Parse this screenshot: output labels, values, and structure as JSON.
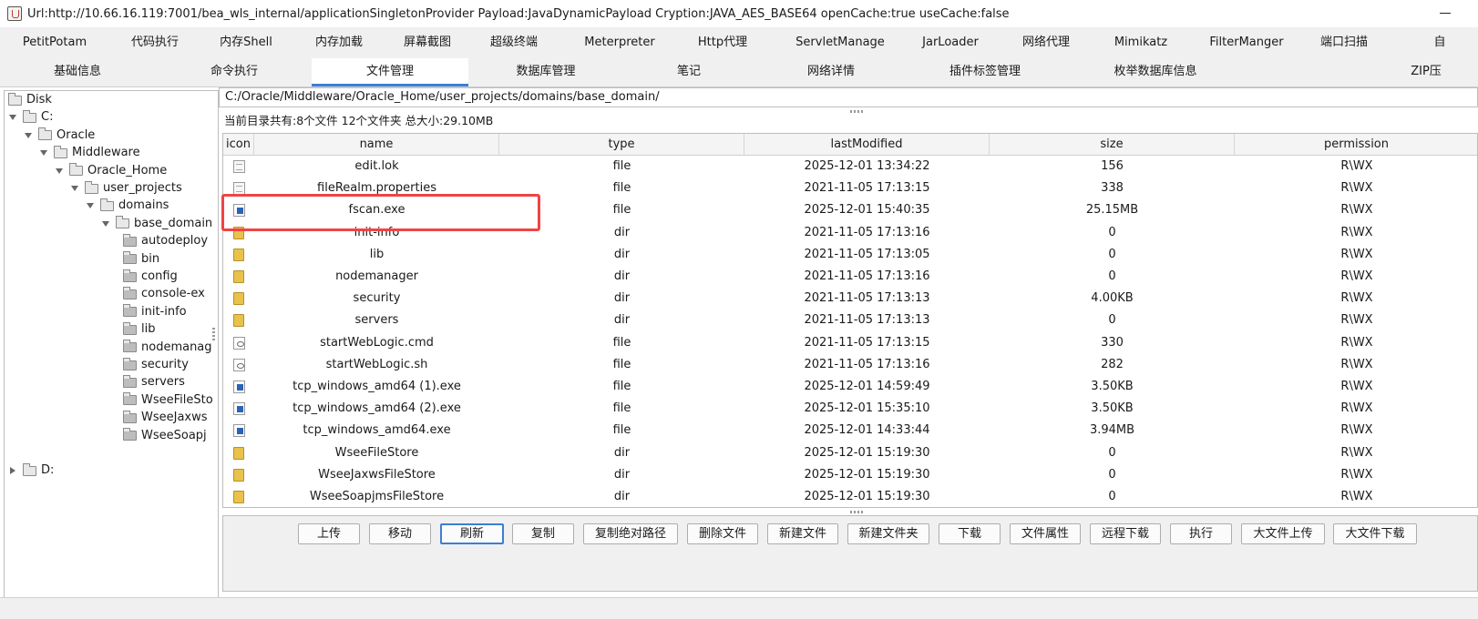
{
  "window": {
    "title": "Url:http://10.66.16.119:7001/bea_wls_internal/applicationSingletonProvider Payload:JavaDynamicPayload Cryption:JAVA_AES_BASE64 openCache:true useCache:false"
  },
  "plugin_tabs": [
    "PetitPotam",
    "代码执行",
    "内存Shell",
    "内存加载",
    "屏幕截图",
    "超级终端",
    "Meterpreter",
    "Http代理",
    "ServletManage",
    "JarLoader",
    "网络代理",
    "Mimikatz",
    "FilterManger",
    "端口扫描",
    "自"
  ],
  "sub_tabs": [
    "基础信息",
    "命令执行",
    "文件管理",
    "数据库管理",
    "笔记",
    "网络详情",
    "插件标签管理",
    "枚举数据库信息",
    "ZIP压"
  ],
  "active_sub_tab": "文件管理",
  "tree": [
    {
      "label": "Disk",
      "depth": 0,
      "state": "root"
    },
    {
      "label": "C:",
      "depth": 0,
      "state": "open"
    },
    {
      "label": "Oracle",
      "depth": 1,
      "state": "open"
    },
    {
      "label": "Middleware",
      "depth": 2,
      "state": "open"
    },
    {
      "label": "Oracle_Home",
      "depth": 3,
      "state": "open"
    },
    {
      "label": "user_projects",
      "depth": 4,
      "state": "open"
    },
    {
      "label": "domains",
      "depth": 5,
      "state": "open"
    },
    {
      "label": "base_domain",
      "depth": 6,
      "state": "open"
    },
    {
      "label": "autodeploy",
      "depth": 7,
      "state": "leaf"
    },
    {
      "label": "bin",
      "depth": 7,
      "state": "leaf"
    },
    {
      "label": "config",
      "depth": 7,
      "state": "leaf"
    },
    {
      "label": "console-ex",
      "depth": 7,
      "state": "leaf"
    },
    {
      "label": "init-info",
      "depth": 7,
      "state": "leaf"
    },
    {
      "label": "lib",
      "depth": 7,
      "state": "leaf"
    },
    {
      "label": "nodemanag",
      "depth": 7,
      "state": "leaf"
    },
    {
      "label": "security",
      "depth": 7,
      "state": "leaf"
    },
    {
      "label": "servers",
      "depth": 7,
      "state": "leaf"
    },
    {
      "label": "WseeFileSto",
      "depth": 7,
      "state": "leaf"
    },
    {
      "label": "WseeJaxws",
      "depth": 7,
      "state": "leaf"
    },
    {
      "label": "WseeSoapj",
      "depth": 7,
      "state": "leaf"
    },
    {
      "label": "D:",
      "depth": 0,
      "state": "closed"
    }
  ],
  "path": "C:/Oracle/Middleware/Oracle_Home/user_projects/domains/base_domain/",
  "summary": "当前目录共有:8个文件 12个文件夹 总大小:29.10MB",
  "table": {
    "columns": [
      "icon",
      "name",
      "type",
      "lastModified",
      "size",
      "permission"
    ],
    "rows": [
      {
        "icon": "file",
        "name": "edit.lok",
        "type": "file",
        "lastModified": "2025-12-01 13:34:22",
        "size": "156",
        "permission": "R\\WX"
      },
      {
        "icon": "file",
        "name": "fileRealm.properties",
        "type": "file",
        "lastModified": "2021-11-05 17:13:15",
        "size": "338",
        "permission": "R\\WX"
      },
      {
        "icon": "exe",
        "name": "fscan.exe",
        "type": "file",
        "lastModified": "2025-12-01 15:40:35",
        "size": "25.15MB",
        "permission": "R\\WX"
      },
      {
        "icon": "dir",
        "name": "init-info",
        "type": "dir",
        "lastModified": "2021-11-05 17:13:16",
        "size": "0",
        "permission": "R\\WX"
      },
      {
        "icon": "dir",
        "name": "lib",
        "type": "dir",
        "lastModified": "2021-11-05 17:13:05",
        "size": "0",
        "permission": "R\\WX"
      },
      {
        "icon": "dir",
        "name": "nodemanager",
        "type": "dir",
        "lastModified": "2021-11-05 17:13:16",
        "size": "0",
        "permission": "R\\WX"
      },
      {
        "icon": "dir",
        "name": "security",
        "type": "dir",
        "lastModified": "2021-11-05 17:13:13",
        "size": "4.00KB",
        "permission": "R\\WX"
      },
      {
        "icon": "dir",
        "name": "servers",
        "type": "dir",
        "lastModified": "2021-11-05 17:13:13",
        "size": "0",
        "permission": "R\\WX"
      },
      {
        "icon": "script",
        "name": "startWebLogic.cmd",
        "type": "file",
        "lastModified": "2021-11-05 17:13:15",
        "size": "330",
        "permission": "R\\WX"
      },
      {
        "icon": "script",
        "name": "startWebLogic.sh",
        "type": "file",
        "lastModified": "2021-11-05 17:13:16",
        "size": "282",
        "permission": "R\\WX"
      },
      {
        "icon": "exe",
        "name": "tcp_windows_amd64 (1).exe",
        "type": "file",
        "lastModified": "2025-12-01 14:59:49",
        "size": "3.50KB",
        "permission": "R\\WX"
      },
      {
        "icon": "exe",
        "name": "tcp_windows_amd64 (2).exe",
        "type": "file",
        "lastModified": "2025-12-01 15:35:10",
        "size": "3.50KB",
        "permission": "R\\WX"
      },
      {
        "icon": "exe",
        "name": "tcp_windows_amd64.exe",
        "type": "file",
        "lastModified": "2025-12-01 14:33:44",
        "size": "3.94MB",
        "permission": "R\\WX"
      },
      {
        "icon": "dir",
        "name": "WseeFileStore",
        "type": "dir",
        "lastModified": "2025-12-01 15:19:30",
        "size": "0",
        "permission": "R\\WX"
      },
      {
        "icon": "dir",
        "name": "WseeJaxwsFileStore",
        "type": "dir",
        "lastModified": "2025-12-01 15:19:30",
        "size": "0",
        "permission": "R\\WX"
      },
      {
        "icon": "dir",
        "name": "WseeSoapjmsFileStore",
        "type": "dir",
        "lastModified": "2025-12-01 15:19:30",
        "size": "0",
        "permission": "R\\WX"
      }
    ]
  },
  "buttons": [
    "上传",
    "移动",
    "刷新",
    "复制",
    "复制绝对路径",
    "删除文件",
    "新建文件",
    "新建文件夹",
    "下载",
    "文件属性",
    "远程下载",
    "执行",
    "大文件上传",
    "大文件下载"
  ],
  "focused_button": "刷新",
  "colors": {
    "accent": "#3b7fd4",
    "highlight": "#ef4444",
    "folder": "#e8c24a"
  }
}
